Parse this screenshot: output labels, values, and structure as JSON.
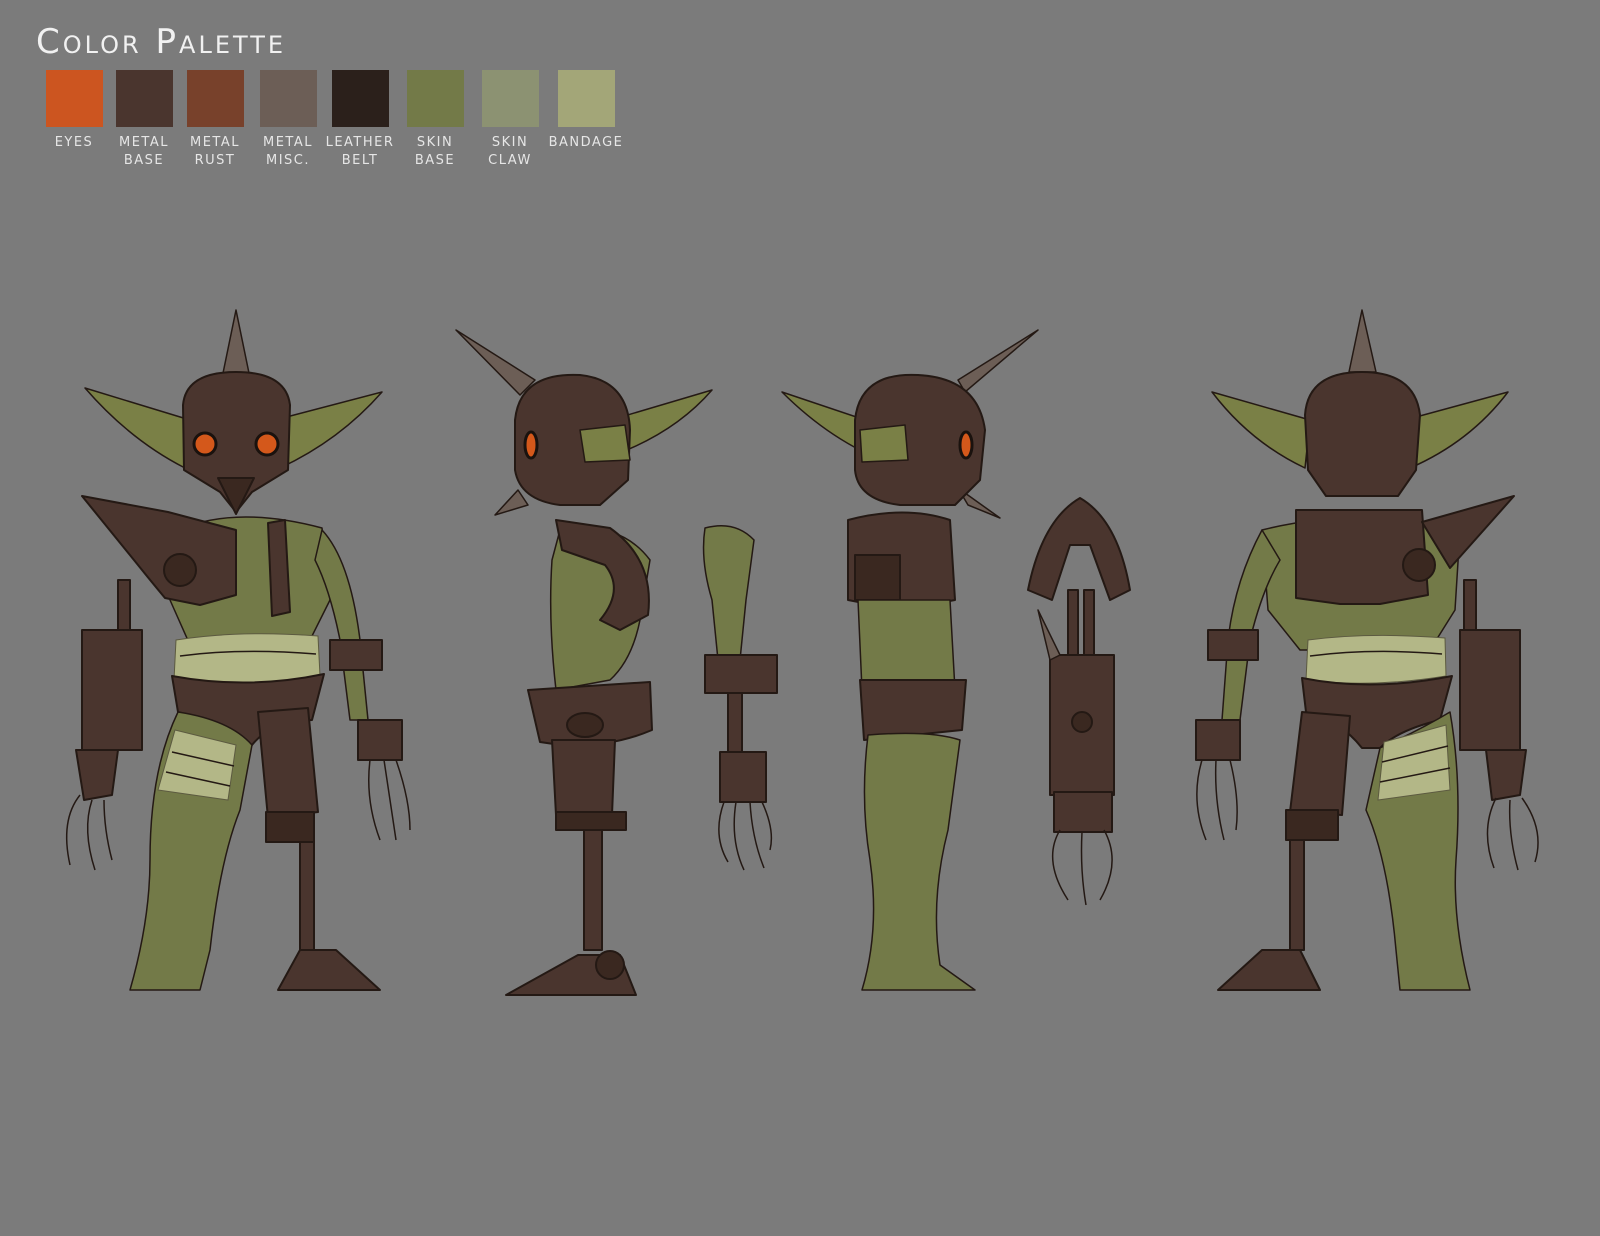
{
  "title": "Color Palette",
  "palette": [
    {
      "label": "EYES",
      "color": "#cc5520"
    },
    {
      "label": "METAL\nBASE",
      "color": "#4a352e"
    },
    {
      "label": "METAL\nRUST",
      "color": "#78412b"
    },
    {
      "label": "METAL\nMISC.",
      "color": "#6c5e56"
    },
    {
      "label": "LEATHER\nBELT",
      "color": "#2b201b"
    },
    {
      "label": "SKIN\nBASE",
      "color": "#737a48"
    },
    {
      "label": "SKIN\nCLAW",
      "color": "#8c9272"
    },
    {
      "label": "BANDAGE",
      "color": "#a3a678"
    }
  ],
  "colors": {
    "background": "#7b7b7b",
    "metal": "#4a352e",
    "metal_dark": "#3a2820",
    "skin": "#737a48",
    "ear": "#7a8046",
    "bandage": "#b3b787",
    "eyes": "#d4581b",
    "horn": "#6c5e56",
    "outline": "#241914"
  }
}
